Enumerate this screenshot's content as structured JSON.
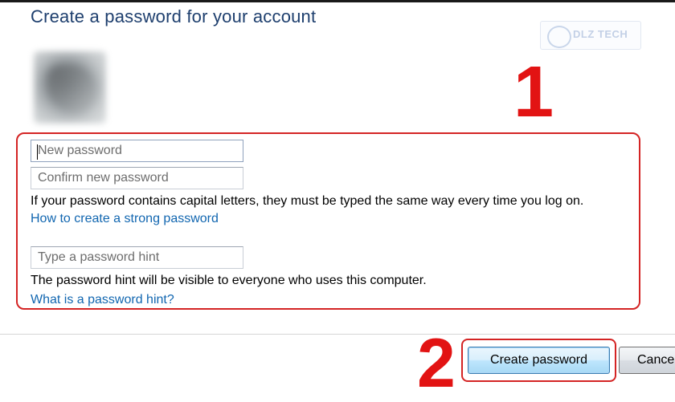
{
  "header": {
    "title": "Create a password for your account"
  },
  "watermark": {
    "text": "DLZ TECH",
    "icon": "logo-mark-icon"
  },
  "user": {
    "avatar_icon": "user-avatar-picture",
    "name": "",
    "role": ""
  },
  "form": {
    "new_password": {
      "placeholder": "New password",
      "value": ""
    },
    "confirm_password": {
      "placeholder": "Confirm new password",
      "value": ""
    },
    "capitals_note": "If your password contains capital letters, they must be typed the same way every time you log on.",
    "strong_password_link": "How to create a strong password",
    "hint": {
      "placeholder": "Type a password hint",
      "value": ""
    },
    "hint_note": "The password hint will be visible to everyone who uses this computer.",
    "hint_link": "What is a password hint?"
  },
  "annotations": {
    "marker_1": "1",
    "marker_2": "2",
    "color": "#e21313"
  },
  "buttons": {
    "create_label": "Create password",
    "cancel_label": "Cance"
  },
  "colors": {
    "title": "#1e3f6e",
    "link": "#1166b0",
    "highlight": "#d42424"
  }
}
